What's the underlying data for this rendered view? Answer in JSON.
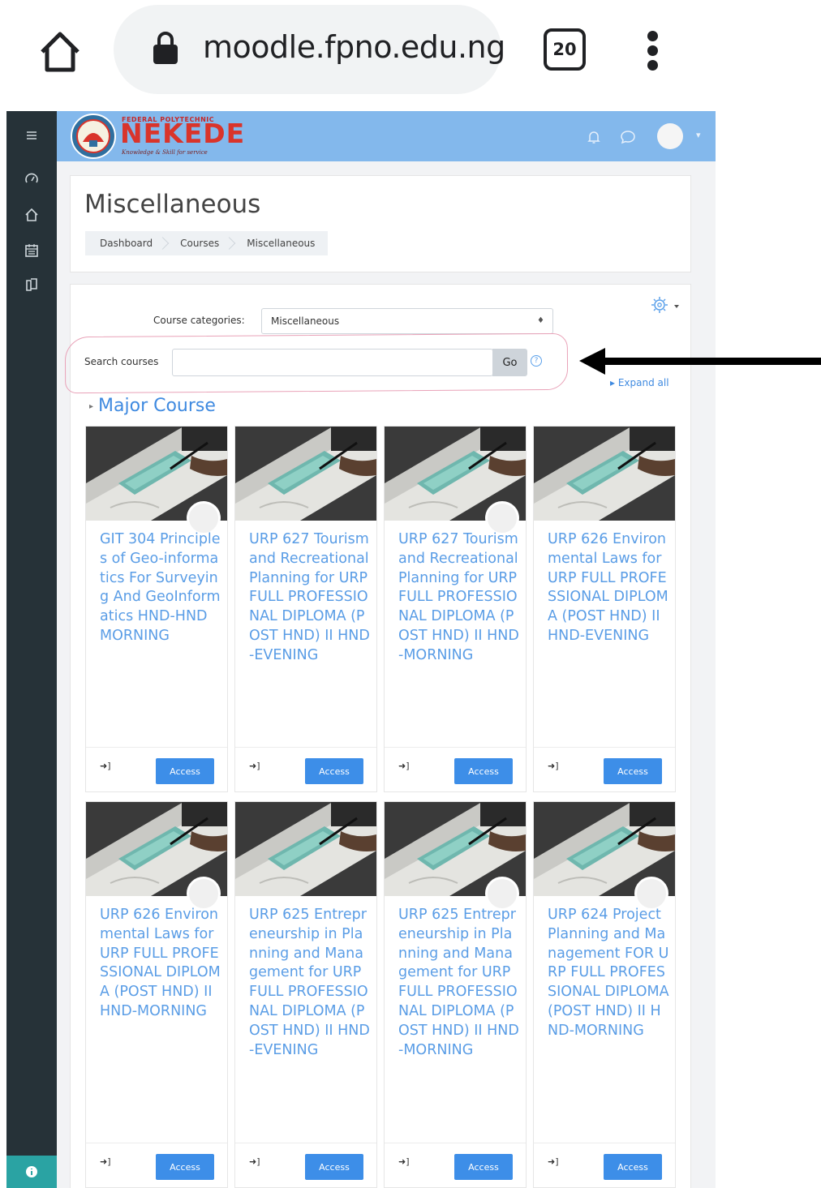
{
  "browser": {
    "url": "moodle.fpno.edu.ng",
    "tab_count": "20",
    "icons": [
      "home-icon",
      "lock-icon",
      "tabs-icon",
      "menu-icon"
    ]
  },
  "navbar": {
    "logo_small": "FEDERAL POLYTECHNIC",
    "logo_main": "NEKEDE",
    "logo_tagline": "Knowledge & Skill for service",
    "brand_color": "#83b8ec"
  },
  "page": {
    "title": "Miscellaneous",
    "breadcrumb": [
      "Dashboard",
      "Courses",
      "Miscellaneous"
    ]
  },
  "filters": {
    "category_label": "Course categories:",
    "category_value": "Miscellaneous",
    "search_label": "Search courses",
    "search_value": "",
    "go_label": "Go",
    "help_glyph": "?"
  },
  "expand_all_label": "Expand all",
  "section": {
    "title": "Major Course"
  },
  "access_label": "Access",
  "courses": [
    {
      "title": "GIT 304 Principles of Geo-informatics For Surveying And GeoInformatics HND-HND MORNING"
    },
    {
      "title": "URP 627 Tourism and Recreational Planning for URP FULL PROFESSIONAL DIPLOMA (POST HND) II HND-EVENING"
    },
    {
      "title": "URP 627 Tourism and Recreational Planning for URP FULL PROFESSIONAL DIPLOMA (POST HND) II HND-MORNING"
    },
    {
      "title": "URP 626 Environmental Laws for URP FULL PROFESSIONAL DIPLOMA (POST HND) II HND-EVENING"
    },
    {
      "title": "URP 626 Environmental Laws for URP FULL PROFESSIONAL DIPLOMA (POST HND) II HND-MORNING"
    },
    {
      "title": "URP 625 Entrepreneurship in Planning and Management for URP FULL PROFESSIONAL DIPLOMA (POST HND) II HND-EVENING"
    },
    {
      "title": "URP 625 Entrepreneurship in Planning and Management for URP FULL PROFESSIONAL DIPLOMA (POST HND) II HND-MORNING"
    },
    {
      "title": "URP 624 Project Planning and Management FOR URP FULL PROFESSIONAL DIPLOMA (POST HND) II HND-MORNING"
    }
  ],
  "colors": {
    "link": "#5a9de6",
    "button": "#3d8ee8",
    "drawer": "#263238",
    "highlight": "#e9a2b8"
  }
}
